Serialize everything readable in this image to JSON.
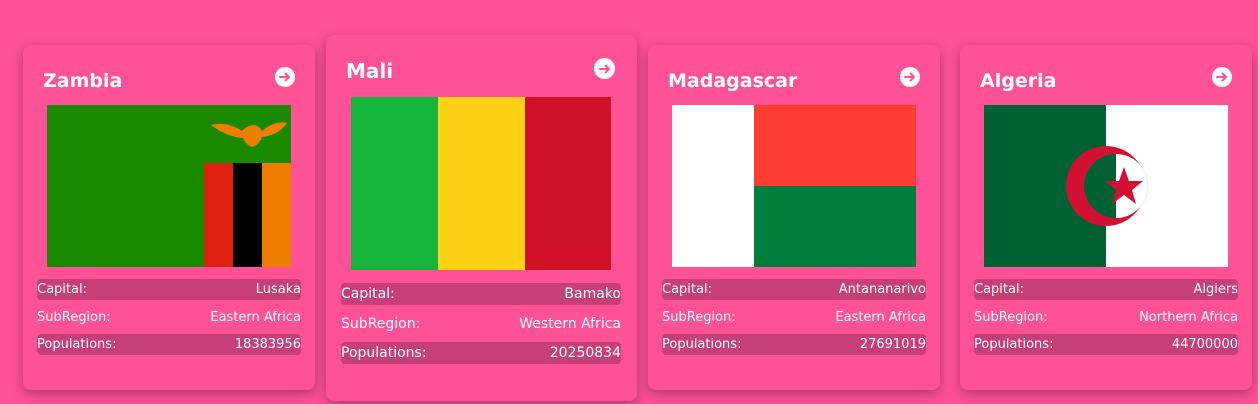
{
  "labels": {
    "capital": "Capital:",
    "subregion": "SubRegion:",
    "population": "Populations:"
  },
  "icons": {
    "details": "arrow-circle-right-icon"
  },
  "colors": {
    "background": "#fe5196",
    "row_shade": "#c73f77"
  },
  "countries": [
    {
      "name": "Zambia",
      "capital": "Lusaka",
      "subregion": "Eastern Africa",
      "population": "18383956"
    },
    {
      "name": "Mali",
      "capital": "Bamako",
      "subregion": "Western Africa",
      "population": "20250834"
    },
    {
      "name": "Madagascar",
      "capital": "Antananarivo",
      "subregion": "Eastern Africa",
      "population": "27691019"
    },
    {
      "name": "Algeria",
      "capital": "Algiers",
      "subregion": "Northern Africa",
      "population": "44700000"
    }
  ]
}
